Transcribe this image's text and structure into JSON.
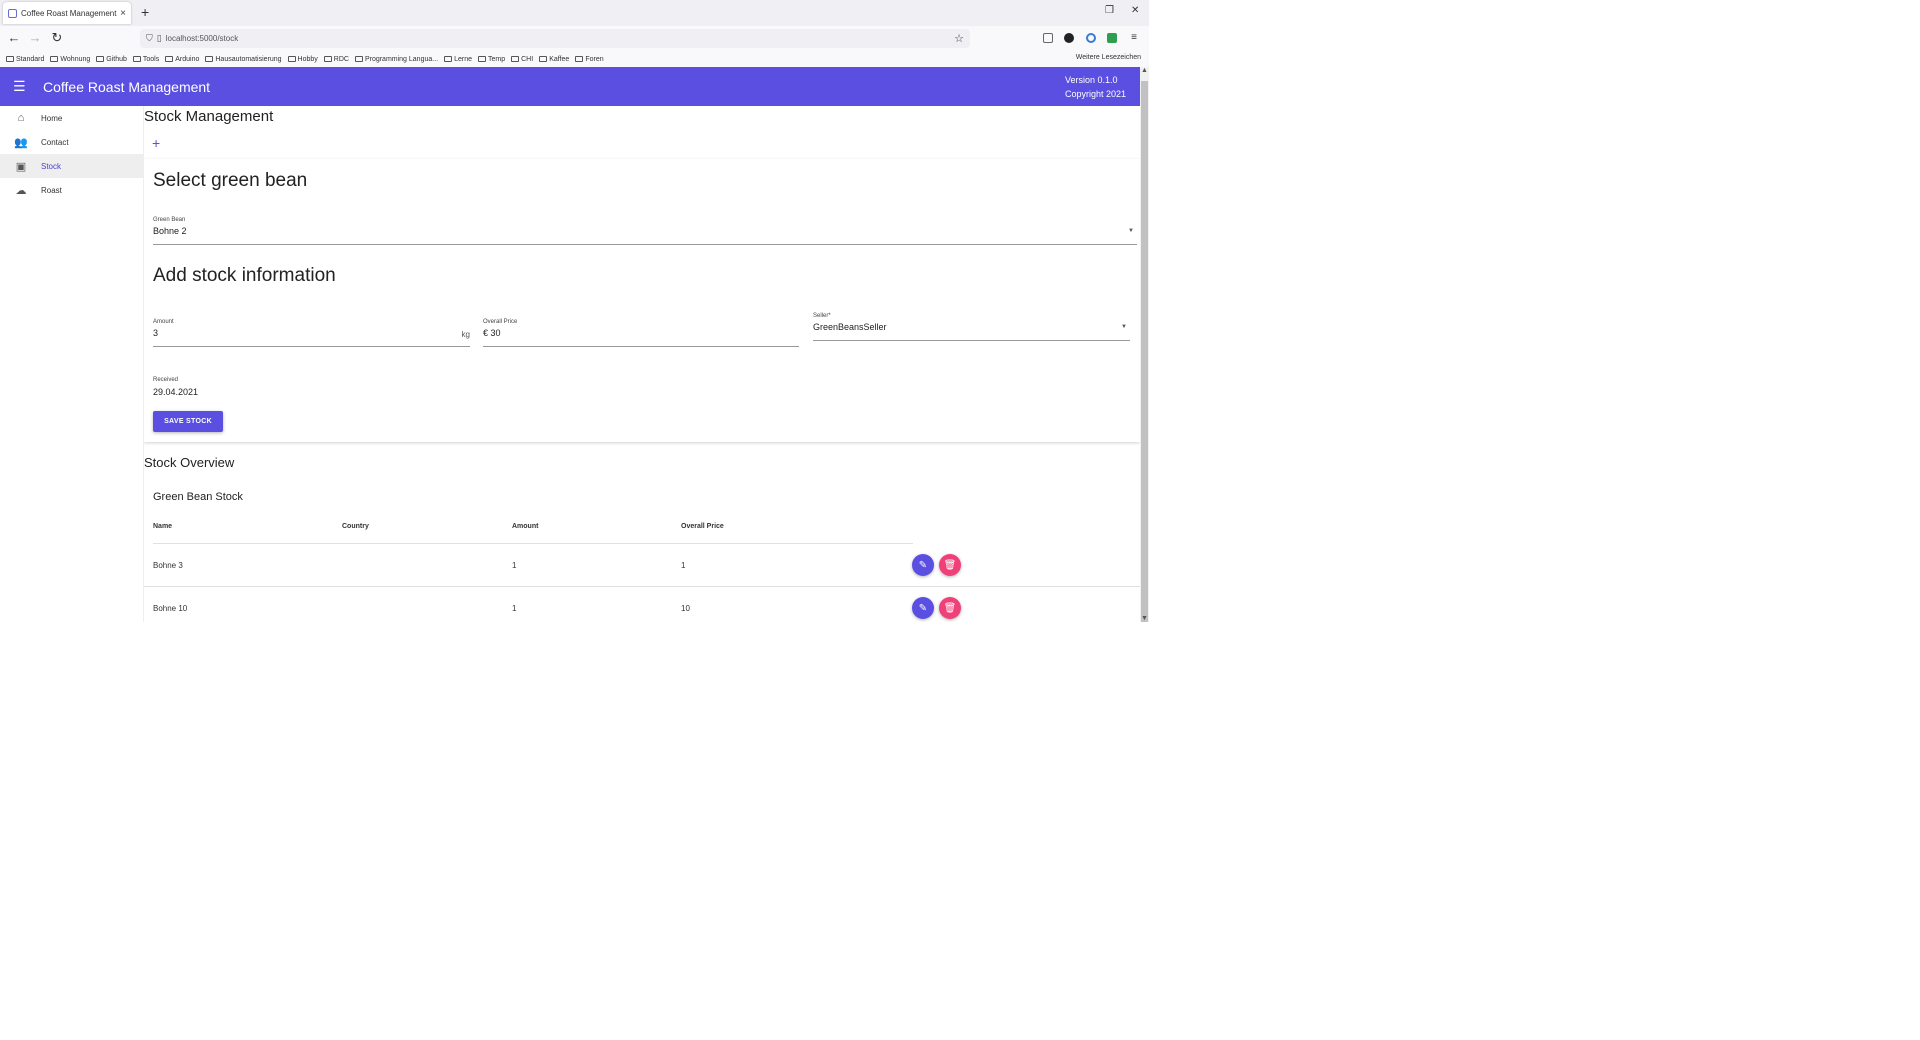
{
  "browser": {
    "tab_title": "Coffee Roast Management",
    "tab_close": "×",
    "new_tab": "+",
    "url": "localhost:5000/stock",
    "bookmarks": [
      "Standard",
      "Wohnung",
      "Github",
      "Tools",
      "Arduino",
      "Hausautomatisierung",
      "Hobby",
      "RDC",
      "Programming Langua...",
      "Lerne",
      "Temp",
      "CHI",
      "Kaffee",
      "Foren"
    ],
    "other_bookmarks": "Weitere Lesezeichen"
  },
  "app": {
    "title": "Coffee Roast Management",
    "version": "Version 0.1.0",
    "copyright": "Copyright 2021",
    "accent": "#5a4fe0",
    "danger": "#f0407a"
  },
  "sidebar": {
    "items": [
      {
        "label": "Home",
        "icon": "home-icon"
      },
      {
        "label": "Contact",
        "icon": "people-icon"
      },
      {
        "label": "Stock",
        "icon": "inventory-icon"
      },
      {
        "label": "Roast",
        "icon": "cloud-icon"
      }
    ],
    "active": "Stock"
  },
  "stock": {
    "heading": "Stock Management",
    "add_symbol": "+",
    "select_heading": "Select green bean",
    "green_bean_label": "Green Bean",
    "green_bean_value": "Bohne 2",
    "add_heading": "Add stock information",
    "amount_label": "Amount",
    "amount_value": "3",
    "amount_unit": "kg",
    "price_label": "Overall Price",
    "price_value": "€ 30",
    "seller_label": "Seller*",
    "seller_value": "GreenBeansSeller",
    "received_label": "Received",
    "received_value": "29.04.2021",
    "save_label": "SAVE STOCK"
  },
  "overview": {
    "heading": "Stock Overview",
    "table_title": "Green Bean Stock",
    "columns": [
      "Name",
      "Country",
      "Amount",
      "Overall Price"
    ],
    "rows": [
      {
        "name": "Bohne 3",
        "country": "",
        "amount": "1",
        "price": "1"
      },
      {
        "name": "Bohne 10",
        "country": "",
        "amount": "1",
        "price": "10"
      }
    ]
  }
}
